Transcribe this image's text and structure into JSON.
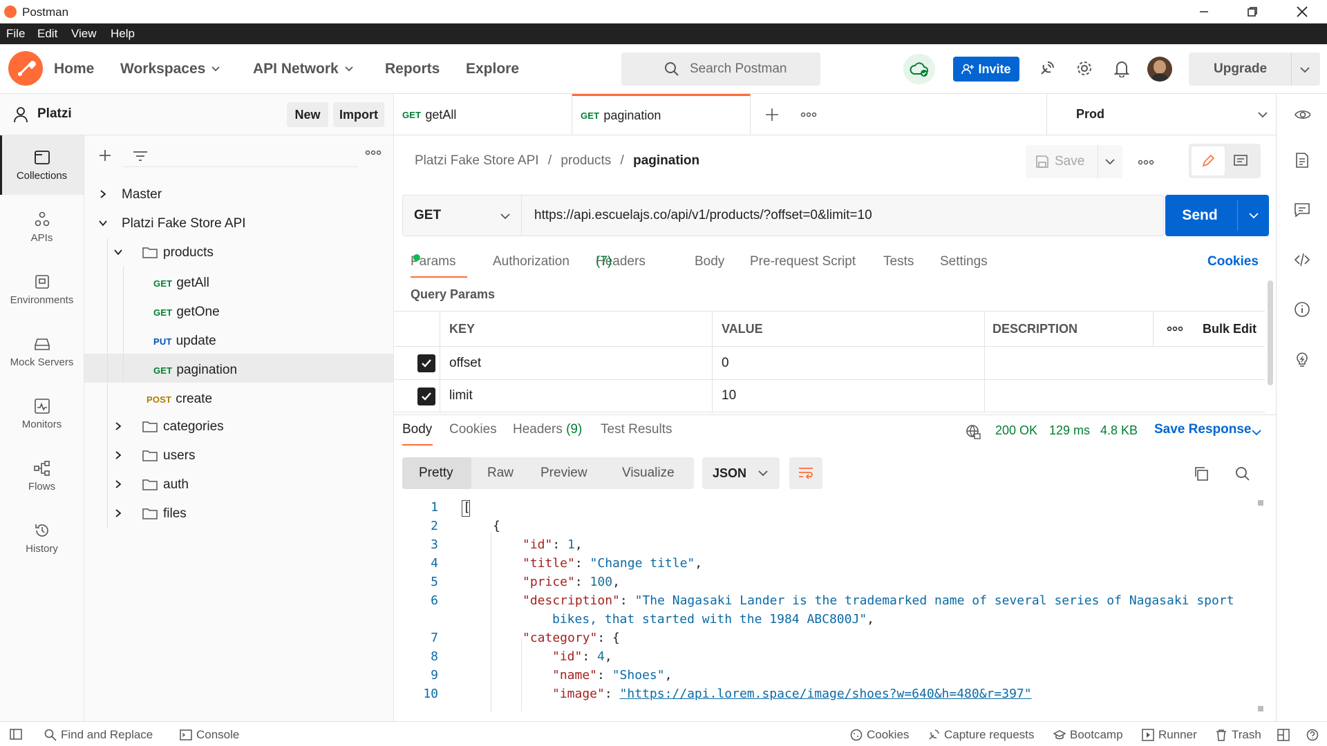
{
  "window": {
    "title": "Postman"
  },
  "menu": [
    "File",
    "Edit",
    "View",
    "Help"
  ],
  "header": {
    "home": "Home",
    "workspaces": "Workspaces",
    "api_network": "API Network",
    "reports": "Reports",
    "explore": "Explore",
    "search_placeholder": "Search Postman",
    "invite": "Invite",
    "upgrade": "Upgrade"
  },
  "workspace": {
    "name": "Platzi",
    "new_label": "New",
    "import_label": "Import"
  },
  "rail": [
    "Collections",
    "APIs",
    "Environments",
    "Mock Servers",
    "Monitors",
    "Flows",
    "History"
  ],
  "tree": [
    {
      "label": "Master",
      "depth": 0,
      "kind": "collection"
    },
    {
      "label": "Platzi Fake Store API",
      "depth": 0,
      "kind": "collection"
    },
    {
      "label": "products",
      "depth": 1,
      "kind": "folder"
    },
    {
      "label": "getAll",
      "depth": 2,
      "kind": "request",
      "method": "GET"
    },
    {
      "label": "getOne",
      "depth": 2,
      "kind": "request",
      "method": "GET"
    },
    {
      "label": "update",
      "depth": 2,
      "kind": "request",
      "method": "PUT"
    },
    {
      "label": "pagination",
      "depth": 2,
      "kind": "request",
      "method": "GET"
    },
    {
      "label": "create",
      "depth": 1,
      "kind": "request",
      "method": "POST"
    },
    {
      "label": "categories",
      "depth": 1,
      "kind": "folder"
    },
    {
      "label": "users",
      "depth": 1,
      "kind": "folder"
    },
    {
      "label": "auth",
      "depth": 1,
      "kind": "folder"
    },
    {
      "label": "files",
      "depth": 1,
      "kind": "folder"
    }
  ],
  "tabs": [
    {
      "method": "GET",
      "label": "getAll"
    },
    {
      "method": "GET",
      "label": "pagination"
    }
  ],
  "environment": "Prod",
  "breadcrumb": [
    "Platzi Fake Store API",
    "products",
    "pagination"
  ],
  "request": {
    "save_label": "Save",
    "method": "GET",
    "url": "https://api.escuelajs.co/api/v1/products/?offset=0&limit=10",
    "send_label": "Send"
  },
  "req_tabs": {
    "params": "Params",
    "authorization": "Authorization",
    "headers": "Headers",
    "headers_count": "(7)",
    "body": "Body",
    "prerequest": "Pre-request Script",
    "tests": "Tests",
    "settings": "Settings",
    "cookies": "Cookies"
  },
  "query_params": {
    "title": "Query Params",
    "columns": [
      "KEY",
      "VALUE",
      "DESCRIPTION"
    ],
    "bulk_edit": "Bulk Edit",
    "rows": [
      {
        "key": "offset",
        "value": "0",
        "checked": true
      },
      {
        "key": "limit",
        "value": "10",
        "checked": true
      }
    ]
  },
  "response": {
    "tabs": {
      "body": "Body",
      "cookies": "Cookies",
      "headers": "Headers",
      "headers_count": "(9)",
      "test_results": "Test Results"
    },
    "status": "200 OK",
    "time": "129 ms",
    "size": "4.8 KB",
    "save_response": "Save Response",
    "views": [
      "Pretty",
      "Raw",
      "Preview",
      "Visualize"
    ],
    "format": "JSON"
  },
  "code_lines": [
    {
      "n": "1",
      "indent": 0,
      "parts": [
        [
          "p",
          "["
        ]
      ]
    },
    {
      "n": "2",
      "indent": 1,
      "parts": [
        [
          "p",
          "{"
        ]
      ]
    },
    {
      "n": "3",
      "indent": 2,
      "parts": [
        [
          "k",
          "\"id\""
        ],
        [
          "p",
          ": "
        ],
        [
          "n",
          "1"
        ],
        [
          "p",
          ","
        ]
      ]
    },
    {
      "n": "4",
      "indent": 2,
      "parts": [
        [
          "k",
          "\"title\""
        ],
        [
          "p",
          ": "
        ],
        [
          "s",
          "\"Change title\""
        ],
        [
          "p",
          ","
        ]
      ]
    },
    {
      "n": "5",
      "indent": 2,
      "parts": [
        [
          "k",
          "\"price\""
        ],
        [
          "p",
          ": "
        ],
        [
          "n",
          "100"
        ],
        [
          "p",
          ","
        ]
      ]
    },
    {
      "n": "6",
      "indent": 2,
      "parts": [
        [
          "k",
          "\"description\""
        ],
        [
          "p",
          ": "
        ],
        [
          "s",
          "\"The Nagasaki Lander is the trademarked name of several series of Nagasaki sport"
        ]
      ]
    },
    {
      "n": "",
      "indent": 3,
      "parts": [
        [
          "s",
          "bikes, that started with the 1984 ABC800J\""
        ],
        [
          "p",
          ","
        ]
      ]
    },
    {
      "n": "7",
      "indent": 2,
      "parts": [
        [
          "k",
          "\"category\""
        ],
        [
          "p",
          ": {"
        ]
      ]
    },
    {
      "n": "8",
      "indent": 3,
      "parts": [
        [
          "k",
          "\"id\""
        ],
        [
          "p",
          ": "
        ],
        [
          "n",
          "4"
        ],
        [
          "p",
          ","
        ]
      ]
    },
    {
      "n": "9",
      "indent": 3,
      "parts": [
        [
          "k",
          "\"name\""
        ],
        [
          "p",
          ": "
        ],
        [
          "s",
          "\"Shoes\""
        ],
        [
          "p",
          ","
        ]
      ]
    },
    {
      "n": "10",
      "indent": 3,
      "parts": [
        [
          "k",
          "\"image\""
        ],
        [
          "p",
          ": "
        ],
        [
          "s",
          "\"https://api.lorem.space/image/shoes?w=640&h=480&r=397\""
        ]
      ]
    }
  ],
  "status_bar": {
    "find_replace": "Find and Replace",
    "console": "Console",
    "cookies": "Cookies",
    "capture": "Capture requests",
    "bootcamp": "Bootcamp",
    "runner": "Runner",
    "trash": "Trash"
  },
  "colors": {
    "accent": "#ff6c37",
    "primary": "#0265d2",
    "get": "#007f31",
    "put": "#0053b8",
    "post": "#ad7a03"
  }
}
